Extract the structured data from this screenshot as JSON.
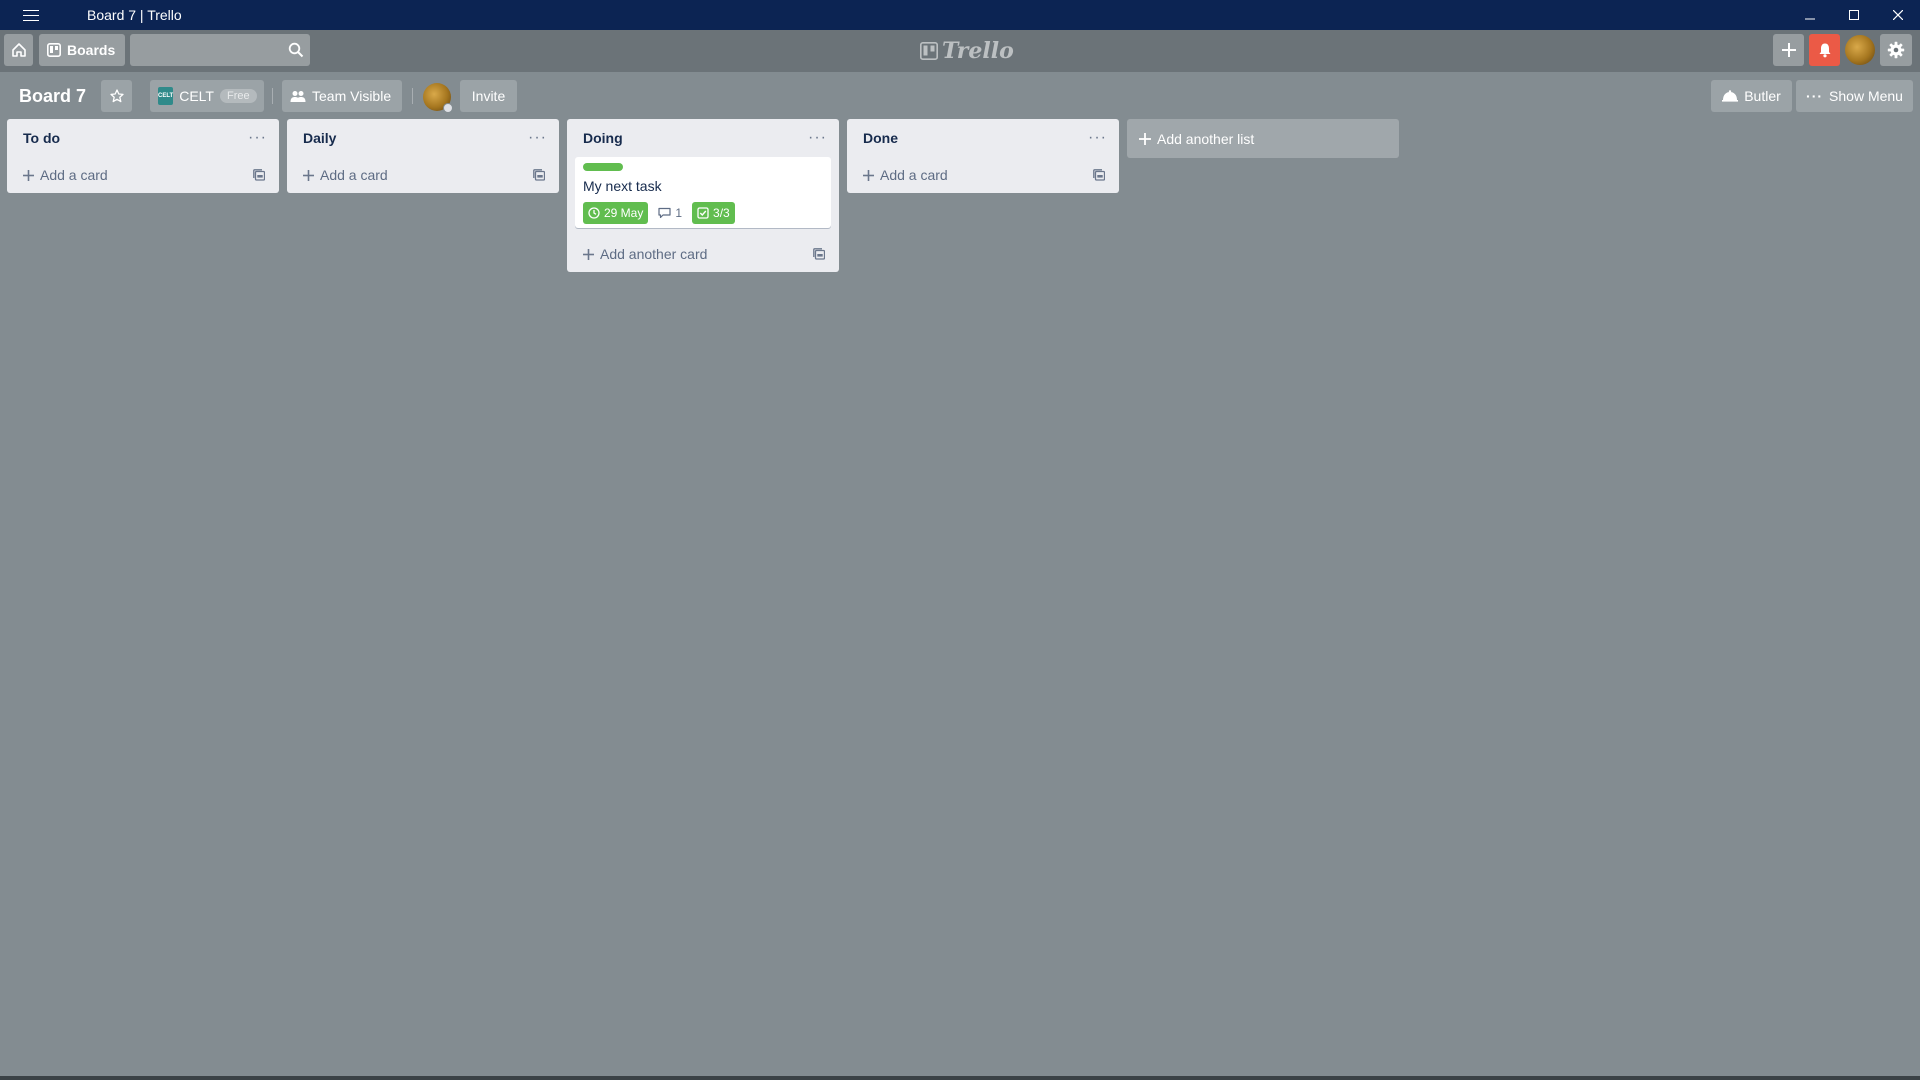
{
  "window": {
    "title": "Board 7 | Trello"
  },
  "header": {
    "boards_label": "Boards",
    "search_value": "",
    "logo_text": "Trello"
  },
  "board": {
    "title": "Board 7",
    "team_name": "CELT",
    "team_badge": "CELT",
    "plan_badge": "Free",
    "visibility": "Team Visible",
    "invite_label": "Invite",
    "butler_label": "Butler",
    "show_menu_label": "Show Menu"
  },
  "lists": [
    {
      "title": "To do",
      "menu": "···",
      "add_label": "Add a card",
      "cards": []
    },
    {
      "title": "Daily",
      "menu": "···",
      "add_label": "Add a card",
      "cards": []
    },
    {
      "title": "Doing",
      "menu": "···",
      "add_label": "Add another card",
      "cards": [
        {
          "label_color": "#61bd4f",
          "title": "My next task",
          "due": "29 May",
          "comments": "1",
          "checklist": "3/3"
        }
      ]
    },
    {
      "title": "Done",
      "menu": "···",
      "add_label": "Add a card",
      "cards": []
    }
  ],
  "add_list_label": "Add another list",
  "colors": {
    "window_titlebar": "#0c2453",
    "board_background": "#838c91",
    "header_background": "#6b7378",
    "notify_red": "#eb5a46",
    "label_green": "#61bd4f"
  }
}
